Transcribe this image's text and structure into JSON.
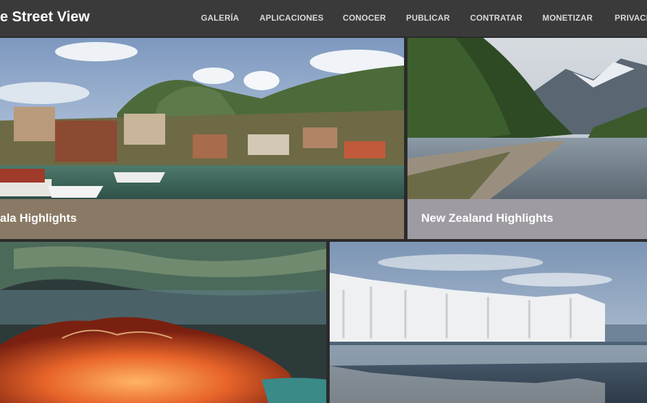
{
  "header": {
    "brand": "e  Street View",
    "nav": [
      "GALERÍA",
      "APLICACIONES",
      "CONOCER",
      "PUBLICAR",
      "CONTRATAR",
      "MONETIZAR",
      "PRIVACI"
    ]
  },
  "gallery": {
    "tiles": [
      {
        "caption": "ala Highlights",
        "caption_color": "#8a7a65"
      },
      {
        "caption": "New Zealand Highlights",
        "caption_color": "#9f9ba3"
      },
      {
        "caption": ""
      },
      {
        "caption": ""
      }
    ]
  }
}
